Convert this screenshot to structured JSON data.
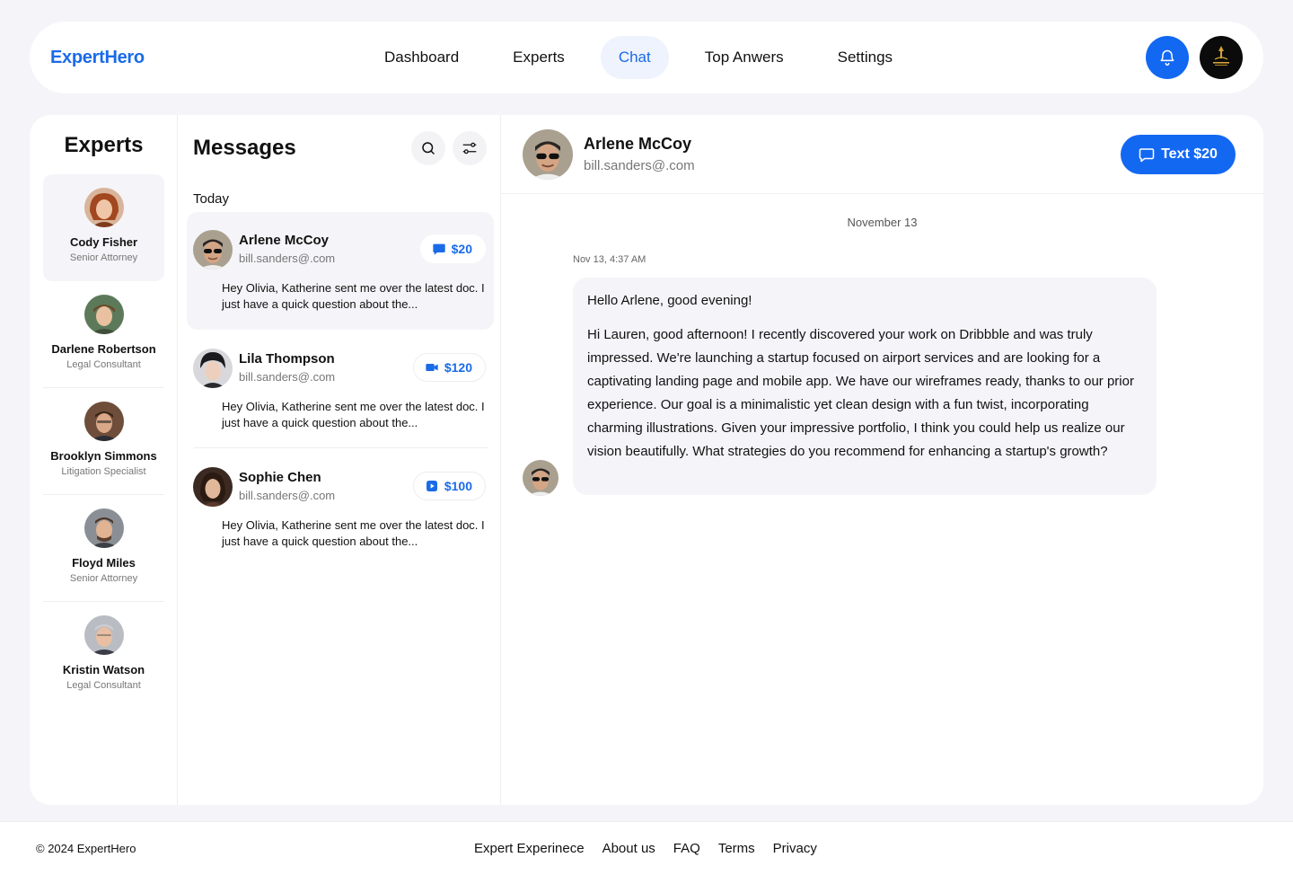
{
  "brand": "ExpertHero",
  "nav": {
    "items": [
      {
        "label": "Dashboard"
      },
      {
        "label": "Experts"
      },
      {
        "label": "Chat"
      },
      {
        "label": "Top Anwers"
      },
      {
        "label": "Settings"
      }
    ],
    "active": "Chat"
  },
  "experts": {
    "title": "Experts",
    "items": [
      {
        "name": "Cody Fisher",
        "role": "Senior Attorney"
      },
      {
        "name": "Darlene Robertson",
        "role": "Legal Consultant"
      },
      {
        "name": "Brooklyn Simmons",
        "role": "Litigation Specialist"
      },
      {
        "name": "Floyd Miles",
        "role": "Senior Attorney"
      },
      {
        "name": "Kristin Watson",
        "role": "Legal Consultant"
      }
    ]
  },
  "messages": {
    "title": "Messages",
    "section": "Today",
    "items": [
      {
        "name": "Arlene McCoy",
        "email": "bill.sanders@.com",
        "price": "$20",
        "price_icon": "chat-bubble-icon",
        "preview": "Hey Olivia, Katherine sent me over the latest doc. I just have a quick question about the..."
      },
      {
        "name": "Lila Thompson",
        "email": "bill.sanders@.com",
        "price": "$120",
        "price_icon": "video-camera-icon",
        "preview": "Hey Olivia, Katherine sent me over the latest doc. I just have a quick question about the..."
      },
      {
        "name": "Sophie Chen",
        "email": "bill.sanders@.com",
        "price": "$100",
        "price_icon": "play-icon",
        "preview": "Hey Olivia, Katherine sent me over the latest doc. I just have a quick question about the..."
      }
    ]
  },
  "chat": {
    "name": "Arlene McCoy",
    "email": "bill.sanders@.com",
    "button": "Text $20",
    "date": "November 13",
    "timestamp": "Nov 13, 4:37 AM",
    "greeting": "Hello Arlene, good evening!",
    "body": "Hi Lauren, good afternoon! I recently discovered your work on Dribbble and was truly impressed. We're launching a startup focused on airport services and are looking for a captivating landing page and mobile app. We have our wireframes ready, thanks to our prior experience. Our goal is a minimalistic yet clean design with a fun twist, incorporating charming illustrations. Given your impressive portfolio, I think you could help us realize our vision beautifully. What strategies do you recommend for enhancing a startup's growth?"
  },
  "footer": {
    "copyright": "© 2024 ExpertHero",
    "links": [
      {
        "label": "Expert Experinece"
      },
      {
        "label": "About us"
      },
      {
        "label": "FAQ"
      },
      {
        "label": "Terms"
      },
      {
        "label": "Privacy"
      }
    ]
  },
  "colors": {
    "accent": "#1368f2",
    "brand": "#1a6be8",
    "background": "#f5f4f8"
  }
}
